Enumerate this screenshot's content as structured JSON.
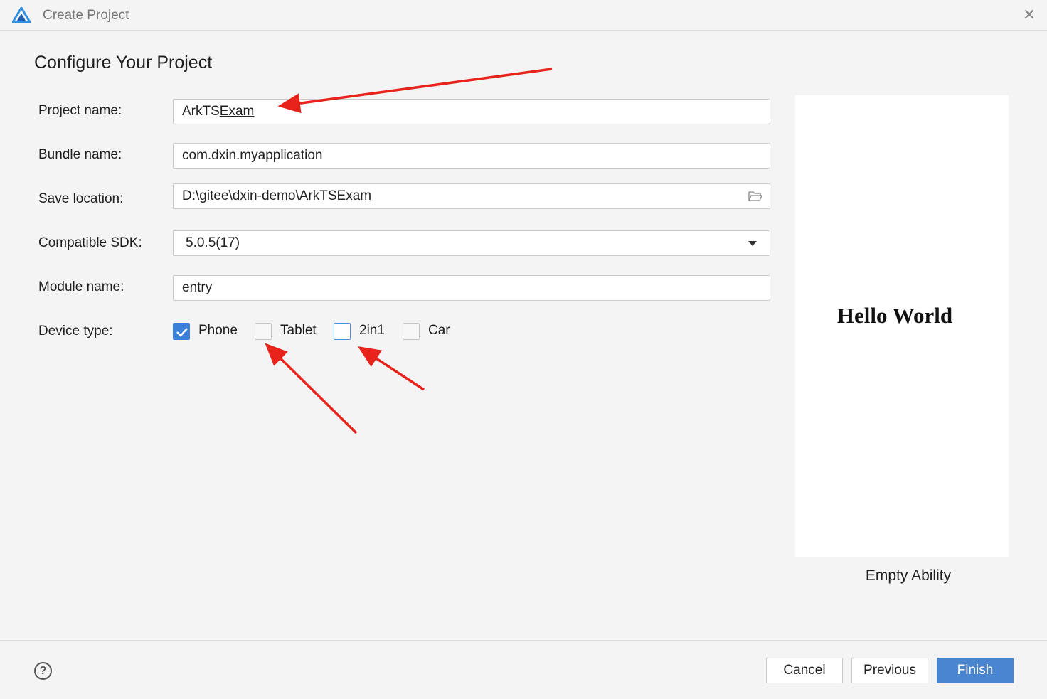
{
  "window": {
    "title": "Create Project",
    "close_symbol": "✕"
  },
  "page": {
    "heading": "Configure Your Project"
  },
  "form": {
    "project_name": {
      "label": "Project name:",
      "value_prefix": "ArkTS",
      "value_underlined": "Exam"
    },
    "bundle_name": {
      "label": "Bundle name:",
      "value": "com.dxin.myapplication"
    },
    "save_location": {
      "label": "Save location:",
      "value": "D:\\gitee\\dxin-demo\\ArkTSExam",
      "icon": "folder-icon"
    },
    "compatible_sdk": {
      "label": "Compatible SDK:",
      "selected": "5.0.5(17)"
    },
    "module_name": {
      "label": "Module name:",
      "value": "entry"
    },
    "device_type": {
      "label": "Device type:",
      "options": [
        {
          "label": "Phone",
          "checked": true
        },
        {
          "label": "Tablet",
          "checked": false
        },
        {
          "label": "2in1",
          "checked": false
        },
        {
          "label": "Car",
          "checked": false
        }
      ]
    }
  },
  "preview": {
    "screen_text": "Hello World",
    "template_name": "Empty Ability"
  },
  "footer": {
    "help_symbol": "?",
    "cancel_label": "Cancel",
    "previous_label": "Previous",
    "finish_label": "Finish"
  },
  "colors": {
    "accent": "#3b7fd9",
    "primary_button": "#4a86cf",
    "annotation_arrow": "#e8231b"
  }
}
